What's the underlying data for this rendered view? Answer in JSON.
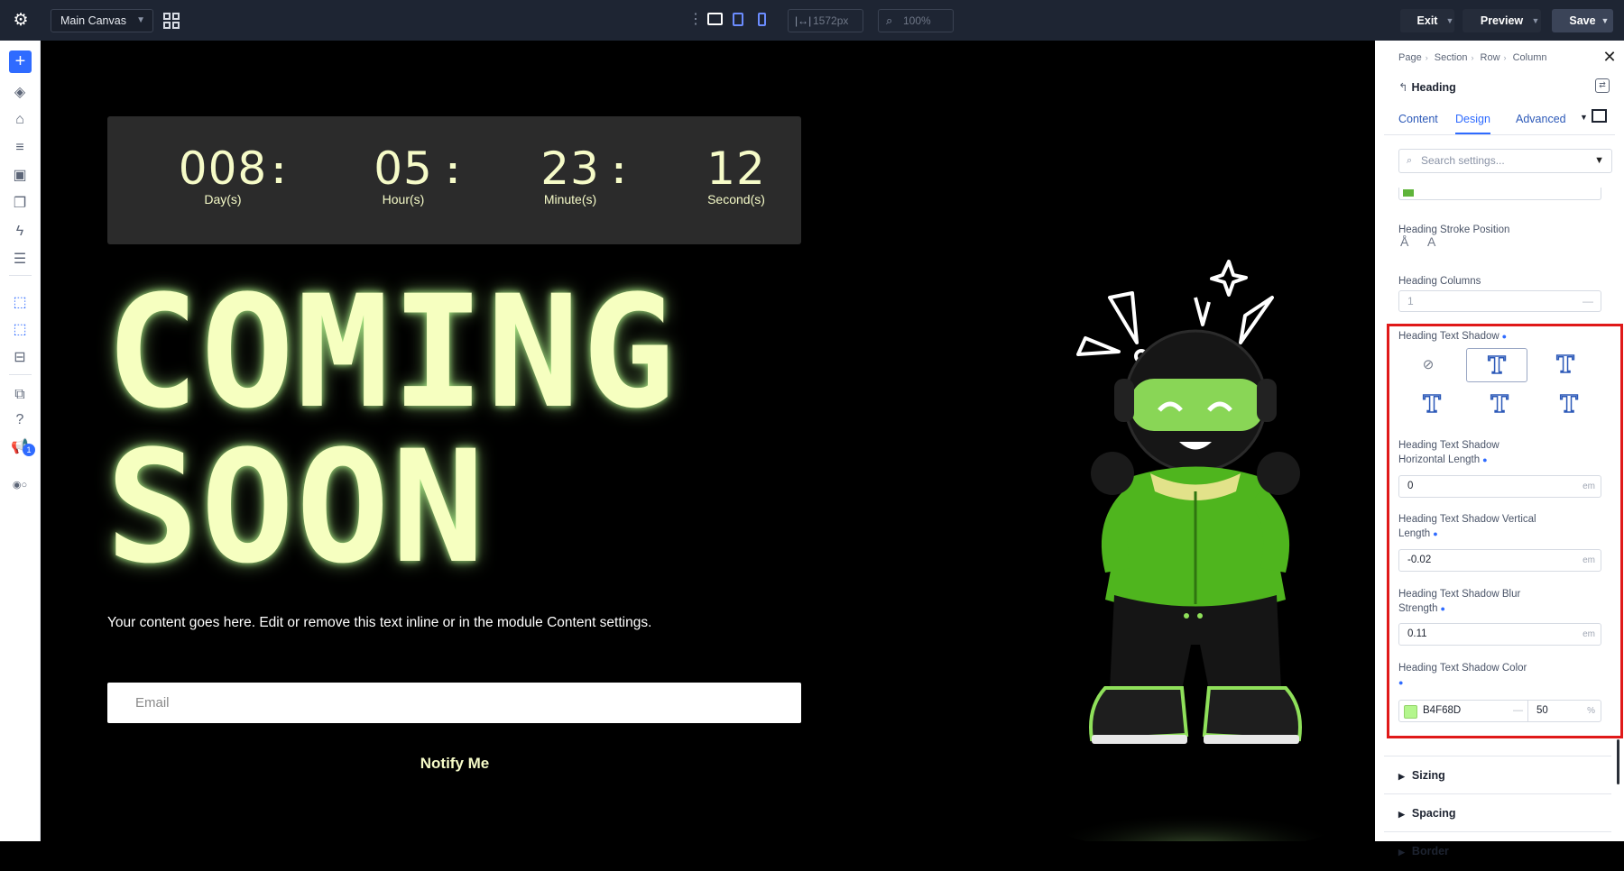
{
  "topbar": {
    "canvas_name": "Main Canvas",
    "width_value": "1572px",
    "zoom_value": "100%",
    "exit_label": "Exit",
    "preview_label": "Preview",
    "save_label": "Save"
  },
  "canvas": {
    "countdown": [
      {
        "number": "008",
        "label": "Day(s)"
      },
      {
        "number": "05",
        "label": "Hour(s)"
      },
      {
        "number": "23",
        "label": "Minute(s)"
      },
      {
        "number": "12",
        "label": "Second(s)"
      }
    ],
    "colon": ":",
    "heading_line1": "COMING",
    "heading_line2": "SOON",
    "body_text": "Your content goes here. Edit or remove this text inline or in the module Content settings.",
    "email_placeholder": "Email",
    "notify_label": "Notify Me"
  },
  "panel": {
    "breadcrumbs": [
      "Page",
      "Section",
      "Row",
      "Column"
    ],
    "module_title": "Heading",
    "tabs": [
      "Content",
      "Design",
      "Advanced"
    ],
    "active_tab": "Design",
    "search_placeholder": "Search settings...",
    "stroke_position_label": "Heading Stroke Position",
    "columns_label": "Heading Columns",
    "columns_value": "1",
    "text_shadow_label": "Heading Text Shadow",
    "h_length_label_1": "Heading Text Shadow",
    "h_length_label_2": "Horizontal Length",
    "h_length_value": "0",
    "v_length_label_1": "Heading Text Shadow Vertical",
    "v_length_label_2": "Length",
    "v_length_value": "-0.02",
    "blur_label_1": "Heading Text Shadow Blur",
    "blur_label_2": "Strength",
    "blur_value": "0.11",
    "unit": "em",
    "color_label": "Heading Text Shadow Color",
    "color_hex": "B4F68D",
    "color_opacity": "50",
    "color_opacity_unit": "%",
    "sections": [
      "Sizing",
      "Spacing",
      "Border"
    ]
  },
  "colors": {
    "accent": "#2f6bff",
    "shadow_color": "#b4f68d",
    "highlight": "#e01919"
  }
}
